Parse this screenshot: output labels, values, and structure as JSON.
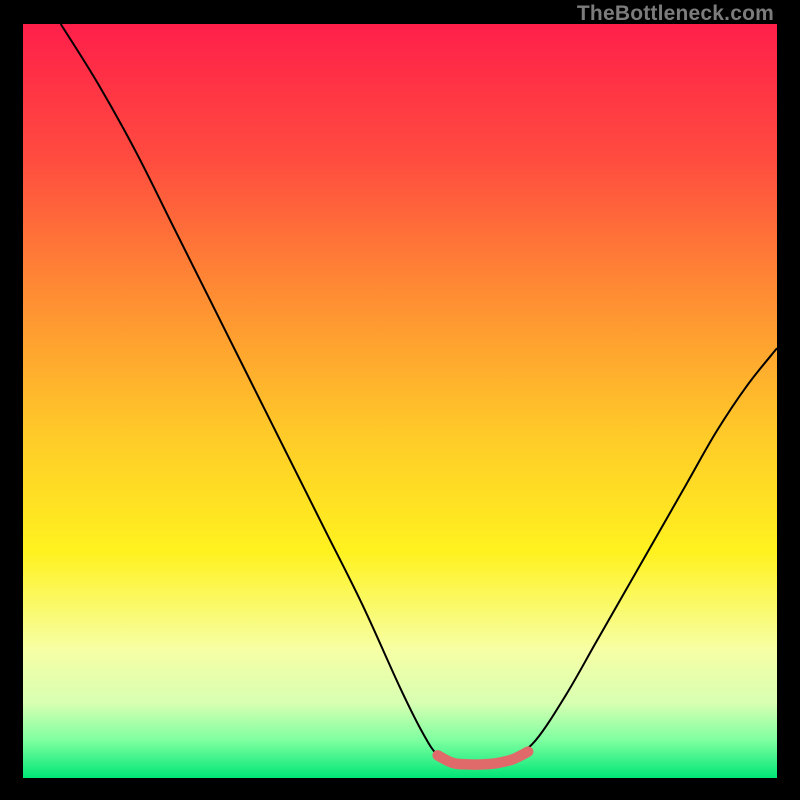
{
  "watermark": "TheBottleneck.com",
  "chart_data": {
    "type": "line",
    "title": "",
    "xlabel": "",
    "ylabel": "",
    "xlim": [
      0,
      100
    ],
    "ylim": [
      0,
      100
    ],
    "grid": false,
    "legend": false,
    "background_gradient": {
      "stops": [
        {
          "offset": 0.0,
          "color": "#ff1f4a"
        },
        {
          "offset": 0.18,
          "color": "#ff4c3f"
        },
        {
          "offset": 0.36,
          "color": "#ff8d33"
        },
        {
          "offset": 0.54,
          "color": "#ffc929"
        },
        {
          "offset": 0.7,
          "color": "#fff21f"
        },
        {
          "offset": 0.83,
          "color": "#f6ffa5"
        },
        {
          "offset": 0.9,
          "color": "#d8ffb2"
        },
        {
          "offset": 0.95,
          "color": "#7effa0"
        },
        {
          "offset": 1.0,
          "color": "#00e676"
        }
      ]
    },
    "series": [
      {
        "name": "left-curve",
        "x": [
          5,
          10,
          15,
          20,
          25,
          30,
          35,
          40,
          45,
          50,
          53,
          55,
          57
        ],
        "y": [
          100,
          92,
          83,
          73,
          63,
          53,
          43,
          33,
          23,
          12,
          6,
          3,
          2
        ]
      },
      {
        "name": "valley-highlight",
        "x": [
          55,
          57,
          59,
          61,
          63,
          65,
          67
        ],
        "y": [
          3,
          2,
          1.8,
          1.8,
          2,
          2.5,
          3.5
        ],
        "stroke": "#e06a6a",
        "stroke_width": 7
      },
      {
        "name": "right-curve",
        "x": [
          65,
          68,
          72,
          76,
          80,
          84,
          88,
          92,
          96,
          100
        ],
        "y": [
          2.5,
          5,
          11,
          18,
          25,
          32,
          39,
          46,
          52,
          57
        ]
      }
    ]
  }
}
